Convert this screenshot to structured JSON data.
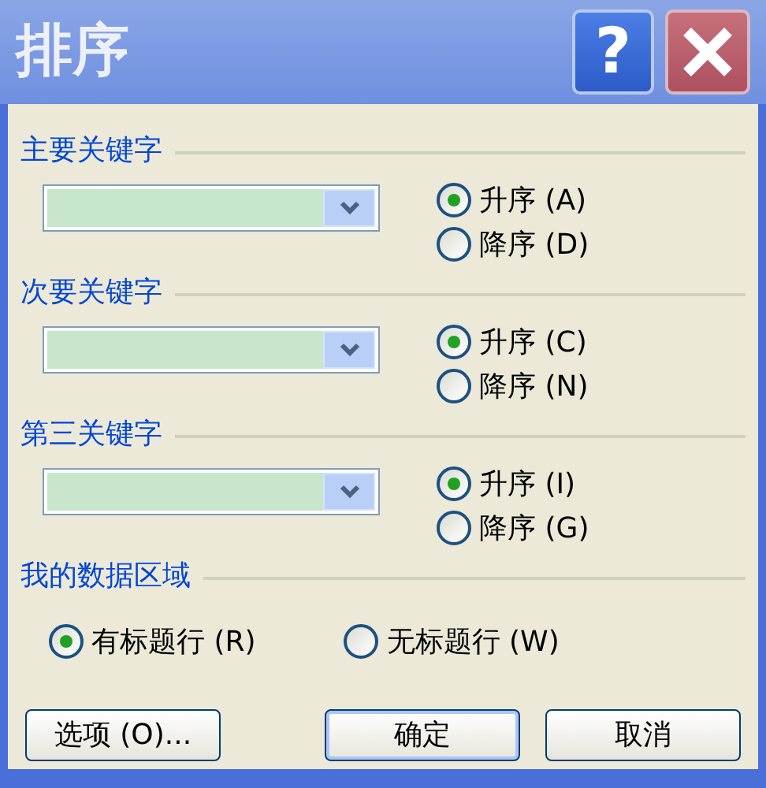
{
  "window": {
    "title": "排序",
    "help_button": "?"
  },
  "sort_keys": [
    {
      "heading": "主要关键字",
      "options": [
        {
          "label": "升序 (A)",
          "selected": true
        },
        {
          "label": "降序 (D)",
          "selected": false
        }
      ]
    },
    {
      "heading": "次要关键字",
      "options": [
        {
          "label": "升序 (C)",
          "selected": true
        },
        {
          "label": "降序 (N)",
          "selected": false
        }
      ]
    },
    {
      "heading": "第三关键字",
      "options": [
        {
          "label": "升序 (I)",
          "selected": true
        },
        {
          "label": "降序 (G)",
          "selected": false
        }
      ]
    }
  ],
  "data_range": {
    "heading": "我的数据区域",
    "options": [
      {
        "label": "有标题行 (R)",
        "selected": true
      },
      {
        "label": "无标题行 (W)",
        "selected": false
      }
    ]
  },
  "buttons": [
    {
      "label": "选项 (O)...",
      "kind": "options"
    },
    {
      "label": "确定",
      "kind": "default"
    },
    {
      "label": "取消",
      "kind": "normal"
    }
  ]
}
